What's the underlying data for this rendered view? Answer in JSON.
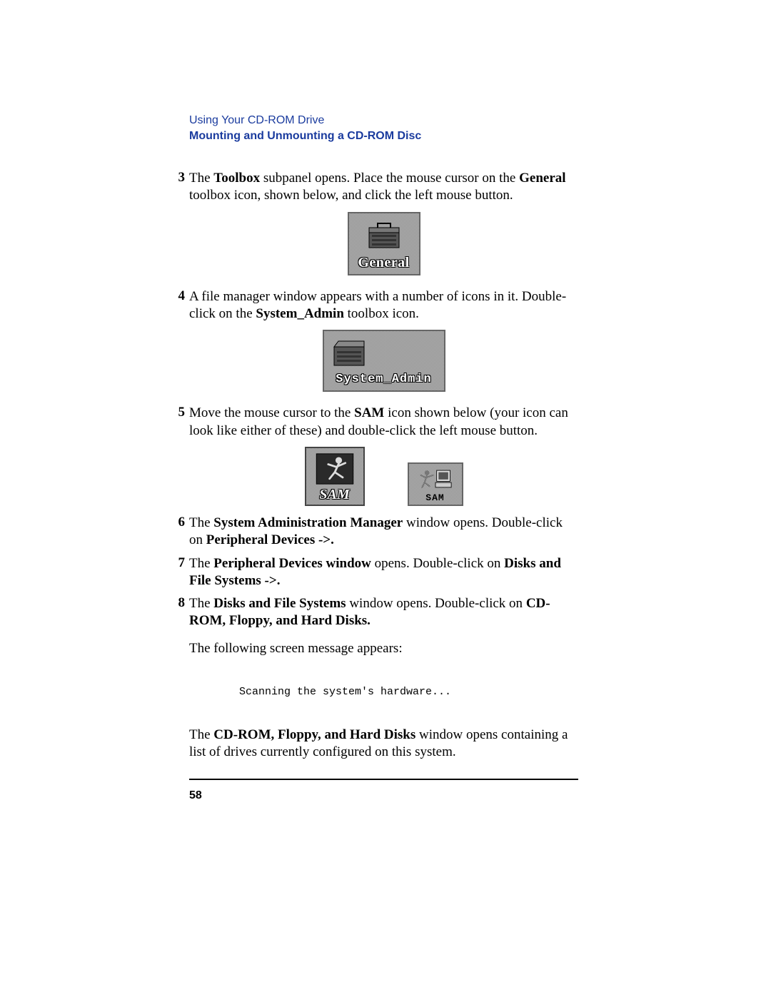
{
  "header": {
    "chapter": "Using Your CD-ROM Drive",
    "section": "Mounting and Unmounting a CD-ROM Disc"
  },
  "steps": {
    "s3": {
      "num": "3",
      "t1": "The ",
      "b1": "Toolbox",
      "t2": " subpanel opens. Place the mouse cursor on the ",
      "b2": "General",
      "t3": " toolbox icon, shown below, and click the left mouse button."
    },
    "s4": {
      "num": "4",
      "t1": "A file manager window appears with a number of icons in it. Double-click on the ",
      "b1": "System_Admin",
      "t2": " toolbox icon."
    },
    "s5": {
      "num": "5",
      "t1": "Move the mouse cursor to the ",
      "b1": "SAM",
      "t2": " icon shown below (your icon can look like either of these) and double-click the left mouse button."
    },
    "s6": {
      "num": "6",
      "t1": "The ",
      "b1": "System Administration Manager",
      "t2": " window opens. Double-click on ",
      "b2": "Peripheral Devices ->."
    },
    "s7": {
      "num": "7",
      "t1": "The ",
      "b1": "Peripheral Devices window",
      "t2": " opens. Double-click on ",
      "b2": "Disks and File Systems ->."
    },
    "s8": {
      "num": "8",
      "t1": "The ",
      "b1": "Disks and File Systems",
      "t2": " window opens. Double-click on ",
      "b2": "CD-ROM, Floppy, and Hard Disks."
    }
  },
  "icons": {
    "general_label": "General",
    "sysadmin_label": "System_Admin",
    "sam1_label": "SAM",
    "sam2_label": "SAM"
  },
  "following_msg": "The following screen message appears:",
  "screen_message": "Scanning the system's hardware...",
  "closing": {
    "t1": "The ",
    "b1": "CD-ROM, Floppy, and Hard Disks",
    "t2": " window opens containing a list of drives currently configured on this system."
  },
  "page_number": "58"
}
